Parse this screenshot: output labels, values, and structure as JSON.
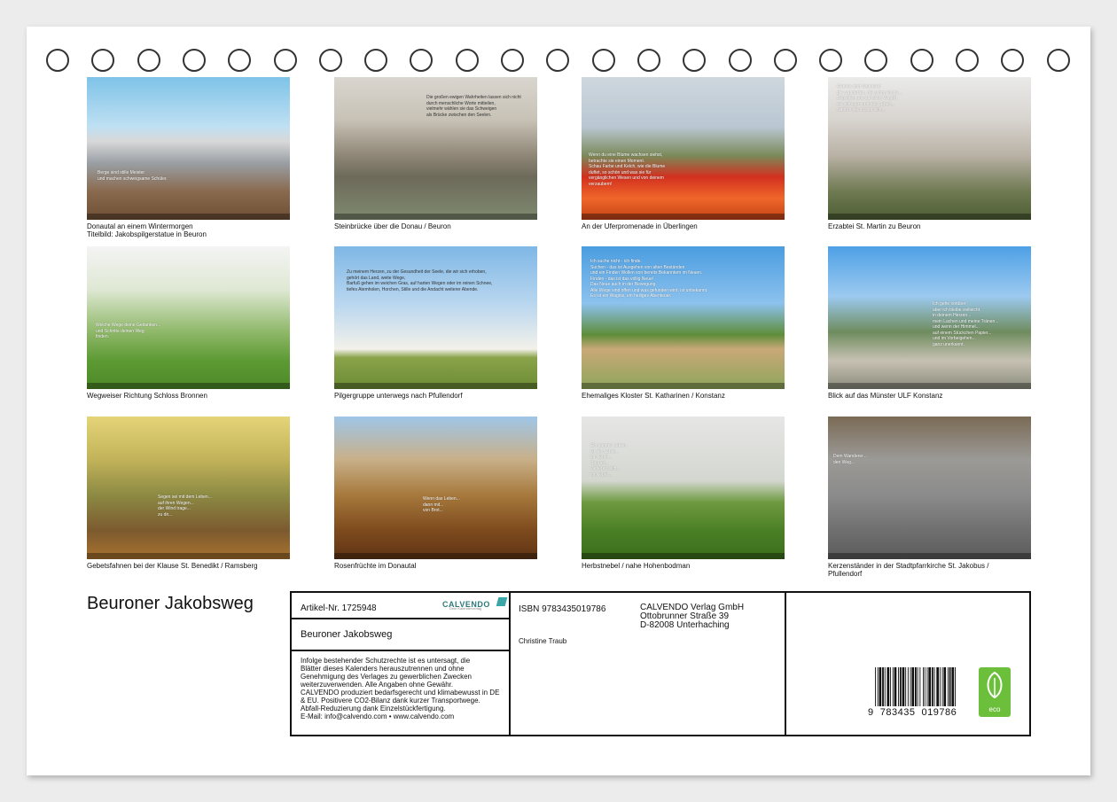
{
  "calendar": {
    "title": "Beuroner Jakobsweg",
    "rings": 23
  },
  "tiles": [
    {
      "caption": "Donautal an einem Wintermorgen\nTitelbild: Jakobspilgerstatue in Beuron",
      "quote": "Berge sind stille Meister\nund machen schweigsame Schüler.",
      "scene": "winter-rocks"
    },
    {
      "caption": "Steinbrücke über die Donau / Beuron",
      "quote": "Die großen ewigen Wahrheiten lassen sich nicht\ndurch menschliche Worte mitteilen,\nvielmehr wählen sie das Schweigen\nals Brücke zwischen den Seelen.",
      "scene": "stone-bridge"
    },
    {
      "caption": "An der Uferpromenade in Überlingen",
      "quote": "Wenn du eine Blume wachsen siehst,\nbetrachte sie einen Moment. \nSchau Farbe und Kelch, wie die Blume\nduftet, so schön und was sie für\nvergänglichen Wesen und von deinem\nverzaubern!",
      "scene": "tulips"
    },
    {
      "caption": "Erzabtei St. Martin zu Beuron",
      "quote": "Gebete sind Wanderer\ndie wanderten, die schon lange...\nBegleiten uns auf allen Wegen\nsie schauen und das Leben...\nwahren sie uns zu sich...",
      "scene": "abbey"
    },
    {
      "caption": "Wegweiser Richtung Schloss Bronnen",
      "quote": "Welche Wege deine Gedanken...\nund Schritte deinen Weg\nfinden.",
      "scene": "signpost"
    },
    {
      "caption": "Pilgergruppe unterwegs nach Pfullendorf",
      "quote": "Zu meinem Herzen, zu der Gesundheit der Seele, die wir sich erhoben,\ngehört das Land, weite Wege,\nBarfuß gehen im weichen Gras, auf harten Wegen oder im reinen Schnee,\ntiefes Atemholen, Horchen, Stille und die Andacht weiterer Abende.",
      "scene": "pilgrims"
    },
    {
      "caption": "Ehemaliges Kloster St. Katharinen / Konstanz",
      "quote": "Ich suche nicht - ich finde.\nSuchen - das ist Ausgehen von alten Beständen\nund ein Finden Wollen von bereits Bekanntem im Neuen.\nFinden - das ist das völlig Neue!\nDas Neue auch in der Bewegung.\nAlle Wege sind offen und was gefunden wird, ist unbekannt.\nEs ist ein Wagnis, ein heiliges Abenteuer.",
      "scene": "monastery"
    },
    {
      "caption": "Blick auf das Münster ULF Konstanz",
      "quote": "Ich gehe vorüber\naber ich bleibe vielleicht\nin deinem Herzen...\nmein Lachen und meine Tränen...\nund wenn der Himmel...\nauf einem Stückchen Papier...\nund im Vorbeigehen...\nganz unerkannt.",
      "scene": "minster"
    },
    {
      "caption": "Gebetsfahnen bei der Klause St. Benedikt / Ramsberg",
      "quote": "Segen sei mit dem Leben...\nauf ihren Wegen...\nder Wind trage...\nzu dir...",
      "scene": "prayer-flags"
    },
    {
      "caption": "Rosenfrüchte im Donautal",
      "quote": "Wenn das Leben...\ndann mit...\nvon Brot...",
      "scene": "rosehips"
    },
    {
      "caption": "Herbstnebel / nahe Hohenbodman",
      "quote": "Ein ganzes Leben\nist ein Nebel...\nim Nebel...\nSpuren...\nverlieren sich...\nim Nebel...",
      "scene": "fog-field"
    },
    {
      "caption": "Kerzenständer in der Stadtpfarrkirche St. Jakobus /\nPfullendorf",
      "quote": "Dem Wanderer...\nden Weg...",
      "scene": "shells"
    }
  ],
  "info": {
    "article_label": "Artikel-Nr. 1725948",
    "title": "Beuroner Jakobsweg",
    "legal": "Infolge bestehender Schutzrechte ist es untersagt, die\nBlätter dieses Kalenders herauszutrennen und ohne\nGenehmigung des Verlages zu gewerblichen Zwecken\nweiterzuverwenden. Alle Angaben ohne Gewähr.\nCALVENDO produziert bedarfsgerecht und klimabewusst in DE\n& EU. Positivere CO2-Bilanz dank kurzer Transportwege.\nAbfall-Reduzierung dank Einzelstückfertigung.\nE-Mail: info@calvendo.com • www.calvendo.com",
    "isbn": "ISBN 9783435019786",
    "author": "Christine Traub",
    "publisher": "CALVENDO Verlag GmbH\nOttobrunner Straße 39\nD-82008 Unterhaching",
    "logo_text": "CALVENDO",
    "logo_sub": "Dein Kalenderverlag",
    "barcode_digits": "9  783435  019786",
    "eco_label": "eco"
  }
}
